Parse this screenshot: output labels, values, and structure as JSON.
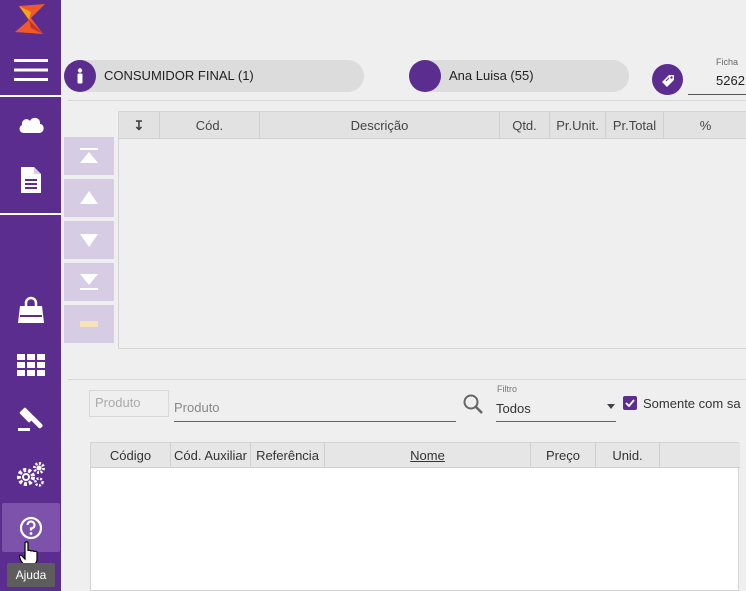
{
  "sidebar": {
    "items": [
      {
        "icon": "menu-icon"
      },
      {
        "icon": "cloud-icon"
      },
      {
        "icon": "document-icon"
      },
      {
        "icon": "shopping-bag-icon"
      },
      {
        "icon": "grid-icon"
      },
      {
        "icon": "gavel-icon"
      },
      {
        "icon": "gears-icon"
      },
      {
        "icon": "help-icon"
      }
    ],
    "tooltip": "Ajuda"
  },
  "header": {
    "customer": "CONSUMIDOR FINAL (1)",
    "seller": "Ana Luisa (55)",
    "ficha_label": "Ficha",
    "ficha_value": "5262"
  },
  "items_grid": {
    "columns": [
      "↧",
      "Cód.",
      "Descrição",
      "Qtd.",
      "Pr.Unit.",
      "Pr.Total",
      "%"
    ],
    "rows": []
  },
  "product_search": {
    "code_placeholder": "Produto",
    "name_placeholder": "Produto",
    "filter_label": "Filtro",
    "filter_value": "Todos",
    "checkbox_label": "Somente com sa",
    "checkbox_checked": true
  },
  "products_grid": {
    "columns": [
      "Código",
      "Cód. Auxiliar",
      "Referência",
      "Nome",
      "Preço",
      "Unid."
    ],
    "rows": []
  },
  "colors": {
    "brand": "#5b2d8e",
    "accent_logo": "#f05a28"
  }
}
